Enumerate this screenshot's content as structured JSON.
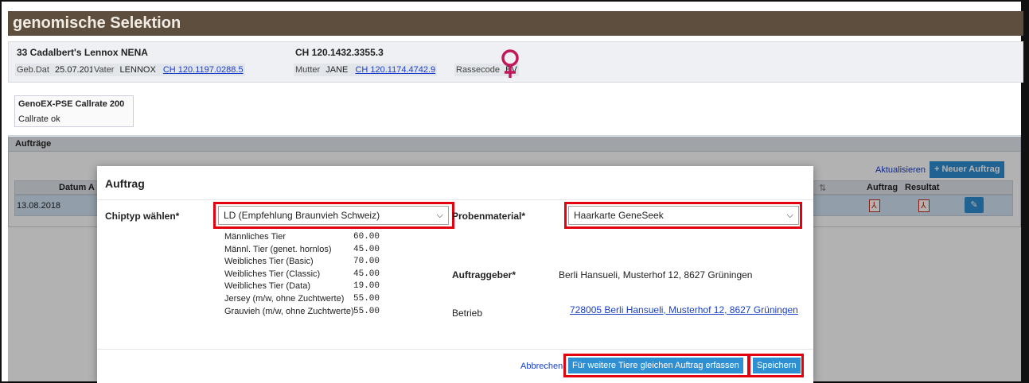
{
  "header": {
    "title": "genomische Selektion"
  },
  "animal": {
    "name": "33  Cadalbert's Lennox NENA",
    "id": "CH 120.1432.3355.3",
    "birth_label": "Geb.Dat",
    "birth_value": "25.07.2018",
    "father_label": "Vater",
    "father_name": "LENNOX",
    "father_id": "CH 120.1197.0288.5",
    "mother_label": "Mutter",
    "mother_name": "JANE",
    "mother_id": "CH 120.1174.4742.9",
    "breed_label": "Rassecode",
    "breed_value": "BV",
    "sex_icon": "female-symbol"
  },
  "genotype": {
    "title": "GenoEX-PSE Callrate 200",
    "status": "Callrate ok"
  },
  "orders": {
    "title": "Aufträge",
    "refresh_label": "Aktualisieren",
    "new_order_label": "+  Neuer Auftrag",
    "columns": {
      "date": "Datum A",
      "sort_icon": "⇅",
      "order": "Auftrag",
      "result": "Resultat"
    },
    "row": {
      "date": "13.08.2018"
    }
  },
  "modal": {
    "title": "Auftrag",
    "chip_label": "Chiptyp wählen*",
    "chip_value": "LD (Empfehlung Braunvieh Schweiz)",
    "sample_label": "Probenmaterial*",
    "sample_value": "Haarkarte GeneSeek",
    "prices": [
      {
        "name": "Männliches Tier",
        "price": "60.00"
      },
      {
        "name": "Männl. Tier (genet. hornlos)",
        "price": "45.00"
      },
      {
        "name": "Weibliches Tier (Basic)",
        "price": "70.00"
      },
      {
        "name": "Weibliches Tier (Classic)",
        "price": "45.00"
      },
      {
        "name": "Weibliches Tier (Data)",
        "price": "19.00"
      },
      {
        "name": "Jersey (m/w, ohne Zuchtwerte)",
        "price": "55.00"
      },
      {
        "name": "Grauvieh (m/w, ohne Zuchtwerte)",
        "price": "55.00"
      }
    ],
    "client_label": "Auftraggeber*",
    "client_value": "Berli Hansueli, Musterhof 12, 8627 Grüningen",
    "farm_label": "Betrieb",
    "farm_value": "728005 Berli Hansueli, Musterhof 12, 8627 Grüningen",
    "cancel_label": "Abbrechen",
    "repeat_label": "Für weitere Tiere gleichen Auftrag erfassen",
    "save_label": "Speichern"
  },
  "colors": {
    "header_bg": "#5e4e3d",
    "accent": "#2f8fd3",
    "highlight": "#e3000f",
    "female": "#c2185b"
  }
}
